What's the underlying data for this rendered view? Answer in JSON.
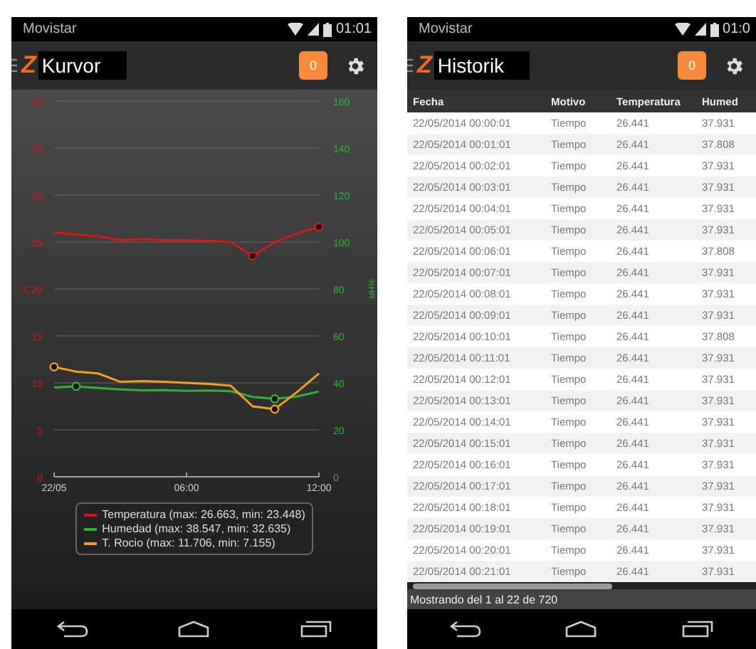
{
  "screens": [
    {
      "kind": "chart",
      "status_bar": {
        "carrier": "Movistar",
        "time": "01:01"
      },
      "app_bar": {
        "logo": "Z",
        "title": "Kurvor",
        "badge": "0"
      },
      "chart_data": {
        "type": "line",
        "grid": true,
        "ylabel": "°C",
        "y2label": "%HR",
        "x": [
          0,
          1,
          2,
          3,
          4,
          5,
          6,
          7,
          8,
          9,
          10,
          11,
          12
        ],
        "xlim": [
          0,
          12
        ],
        "ylim": [
          0,
          40
        ],
        "y2lim": [
          0,
          160
        ],
        "xticks": [
          {
            "value": 0,
            "label": "22/05"
          },
          {
            "value": 6,
            "label": "06:00"
          },
          {
            "value": 12,
            "label": "12:00"
          }
        ],
        "yticks": [
          0,
          5,
          10,
          15,
          20,
          25,
          30,
          35,
          40
        ],
        "y2ticks": [
          0,
          20,
          40,
          60,
          80,
          100,
          120,
          140,
          160
        ],
        "series": [
          {
            "name": "Temperatura",
            "color": "#d0171b",
            "values": [
              26.0,
              25.8,
              25.6,
              25.2,
              25.3,
              25.2,
              25.2,
              25.1,
              25.0,
              23.5,
              25.0,
              25.9,
              26.6
            ]
          },
          {
            "name": "Humedad",
            "color": "#32b035",
            "axis": "y2",
            "values": [
              38.0,
              38.5,
              37.8,
              37.2,
              36.8,
              36.9,
              36.6,
              36.7,
              36.4,
              34.0,
              33.2,
              34.2,
              36.3
            ]
          },
          {
            "name": "T. Rocio",
            "color": "#f0a020",
            "values": [
              11.7,
              11.2,
              11.0,
              10.1,
              10.2,
              10.1,
              10.0,
              9.9,
              9.7,
              7.5,
              7.2,
              9.0,
              11.0
            ]
          }
        ]
      },
      "legend": [
        {
          "stats": "(max: 26.663, min: 23.448)"
        },
        {
          "stats": "(max: 38.547, min: 32.635)"
        },
        {
          "stats": "(max: 11.706, min: 7.155)"
        }
      ]
    },
    {
      "kind": "table",
      "status_bar": {
        "carrier": "Movistar",
        "time": "01:0"
      },
      "app_bar": {
        "logo": "Z",
        "title": "Historik",
        "badge": "0"
      },
      "table": {
        "columns": [
          "Fecha",
          "Motivo",
          "Temperatura",
          "Humed"
        ],
        "rows": [
          [
            "22/05/2014 00:00:01",
            "Tiempo",
            "26.441",
            "37.931"
          ],
          [
            "22/05/2014 00:01:01",
            "Tiempo",
            "26.441",
            "37.808"
          ],
          [
            "22/05/2014 00:02:01",
            "Tiempo",
            "26.441",
            "37.931"
          ],
          [
            "22/05/2014 00:03:01",
            "Tiempo",
            "26.441",
            "37.931"
          ],
          [
            "22/05/2014 00:04:01",
            "Tiempo",
            "26.441",
            "37.931"
          ],
          [
            "22/05/2014 00:05:01",
            "Tiempo",
            "26.441",
            "37.931"
          ],
          [
            "22/05/2014 00:06:01",
            "Tiempo",
            "26.441",
            "37.808"
          ],
          [
            "22/05/2014 00:07:01",
            "Tiempo",
            "26.441",
            "37.931"
          ],
          [
            "22/05/2014 00:08:01",
            "Tiempo",
            "26.441",
            "37.931"
          ],
          [
            "22/05/2014 00:09:01",
            "Tiempo",
            "26.441",
            "37.931"
          ],
          [
            "22/05/2014 00:10:01",
            "Tiempo",
            "26.441",
            "37.808"
          ],
          [
            "22/05/2014 00:11:01",
            "Tiempo",
            "26.441",
            "37.931"
          ],
          [
            "22/05/2014 00:12:01",
            "Tiempo",
            "26.441",
            "37.931"
          ],
          [
            "22/05/2014 00:13:01",
            "Tiempo",
            "26.441",
            "37.931"
          ],
          [
            "22/05/2014 00:14:01",
            "Tiempo",
            "26.441",
            "37.931"
          ],
          [
            "22/05/2014 00:15:01",
            "Tiempo",
            "26.441",
            "37.931"
          ],
          [
            "22/05/2014 00:16:01",
            "Tiempo",
            "26.441",
            "37.931"
          ],
          [
            "22/05/2014 00:17:01",
            "Tiempo",
            "26.441",
            "37.931"
          ],
          [
            "22/05/2014 00:18:01",
            "Tiempo",
            "26.441",
            "37.931"
          ],
          [
            "22/05/2014 00:19:01",
            "Tiempo",
            "26.441",
            "37.931"
          ],
          [
            "22/05/2014 00:20:01",
            "Tiempo",
            "26.441",
            "37.931"
          ],
          [
            "22/05/2014 00:21:01",
            "Tiempo",
            "26.441",
            "37.931"
          ]
        ]
      },
      "footer": "Mostrando del 1 al 22 de 720"
    }
  ]
}
